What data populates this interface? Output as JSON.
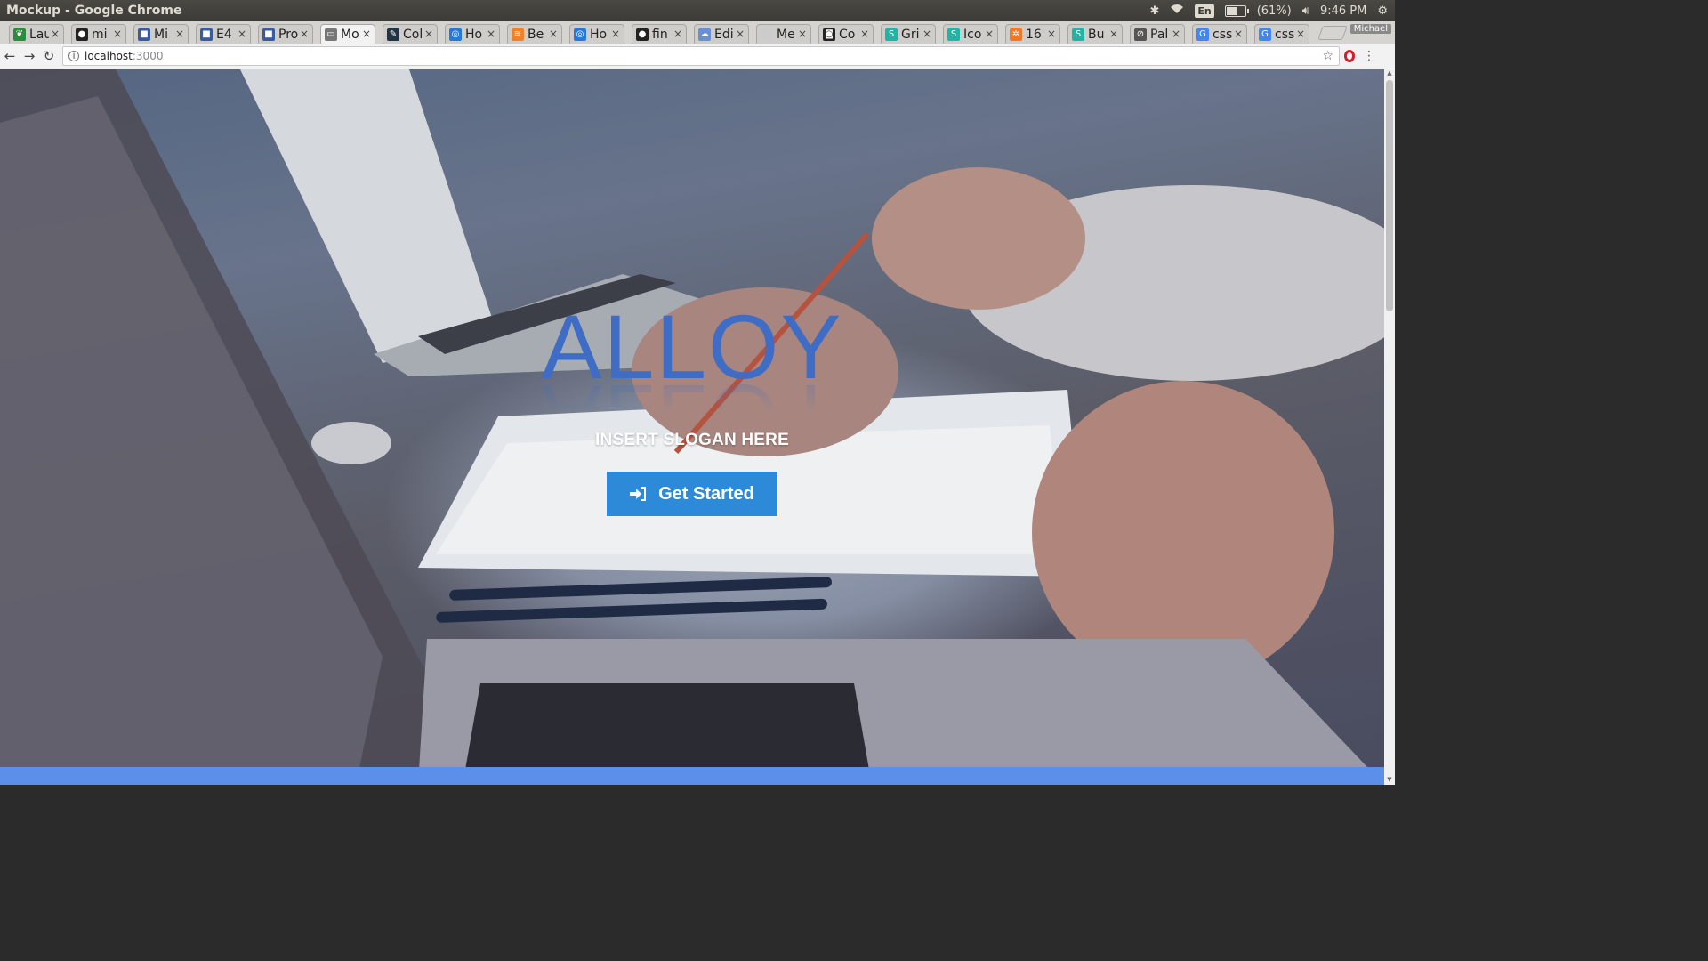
{
  "os": {
    "window_title": "Mockup - Google Chrome",
    "language": "En",
    "battery": "(61%)",
    "battery_level": 0.61,
    "clock": "9:46 PM"
  },
  "tabs": [
    {
      "label": "Lau",
      "icon": "leaf-icon",
      "color": "#2e8b3d"
    },
    {
      "label": "mi",
      "icon": "github-icon",
      "color": "#222222"
    },
    {
      "label": "Mi",
      "icon": "doc-icon",
      "color": "#3b5b9b"
    },
    {
      "label": "E4",
      "icon": "doc-icon",
      "color": "#3b5b9b"
    },
    {
      "label": "Pro",
      "icon": "doc-icon",
      "color": "#3b5b9b"
    },
    {
      "label": "Mo",
      "icon": "page-icon",
      "color": "#777777",
      "active": true
    },
    {
      "label": "Col",
      "icon": "edit-icon",
      "color": "#234"
    },
    {
      "label": "Ho",
      "icon": "spiral-icon",
      "color": "#2a78d6"
    },
    {
      "label": "Be",
      "icon": "stack-icon",
      "color": "#f48024"
    },
    {
      "label": "Ho",
      "icon": "spiral-icon",
      "color": "#2a78d6"
    },
    {
      "label": "fin",
      "icon": "github-icon",
      "color": "#222222"
    },
    {
      "label": "Edi",
      "icon": "cloud-icon",
      "color": "#6b8fd6"
    },
    {
      "label": "Me",
      "icon": "blank-icon",
      "color": "#cccccc"
    },
    {
      "label": "Co",
      "icon": "camera-icon",
      "color": "#222222"
    },
    {
      "label": "Gri",
      "icon": "s-icon",
      "color": "#1fb5a6"
    },
    {
      "label": "Ico",
      "icon": "s-icon",
      "color": "#1fb5a6"
    },
    {
      "label": "16",
      "icon": "hubspot-icon",
      "color": "#f57722"
    },
    {
      "label": "Bu",
      "icon": "s-icon",
      "color": "#1fb5a6"
    },
    {
      "label": "Pal",
      "icon": "compass-icon",
      "color": "#555555"
    },
    {
      "label": "css",
      "icon": "google-icon",
      "color": "#4285f4"
    },
    {
      "label": "css",
      "icon": "google-icon",
      "color": "#4285f4"
    }
  ],
  "profile_name": "Michael",
  "address": {
    "host": "localhost",
    "port": ":3000"
  },
  "hero": {
    "brand": "ALLOY",
    "slogan": "INSERT SLOGAN HERE",
    "cta_label": "Get Started",
    "cta_icon": "sign-in-icon"
  },
  "colors": {
    "brand_blue": "#3f6cc4",
    "cta_blue": "#2d8ad9",
    "bottom_strip": "#5b8fea"
  }
}
